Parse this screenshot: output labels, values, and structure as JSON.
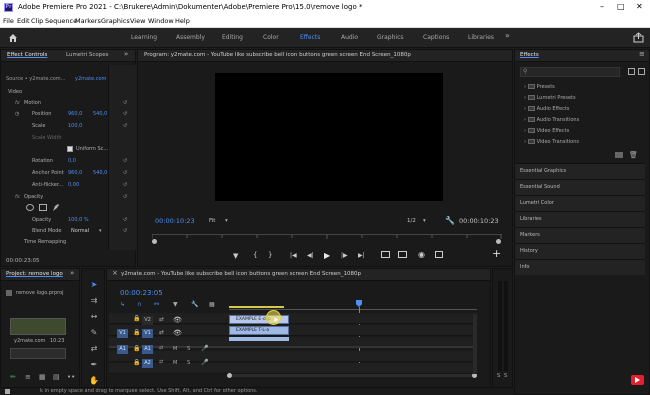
{
  "app": {
    "title": "Adobe Premiere Pro 2021 - C:\\Brukere\\Admin\\Dokumenter\\Adobe\\Premiere Pro\\15.0\\remove logo *",
    "icon_label": "Pr"
  },
  "menu": [
    "File",
    "Edit",
    "Clip",
    "Sequence",
    "Markers",
    "Graphics",
    "View",
    "Window",
    "Help"
  ],
  "workspaces": {
    "items": [
      "Learning",
      "Assembly",
      "Editing",
      "Color",
      "Effects",
      "Audio",
      "Graphics",
      "Captions",
      "Libraries"
    ],
    "active": "Effects"
  },
  "effect_controls": {
    "tabs": [
      "Effect Controls",
      "Lumetri Scopes"
    ],
    "source": "Source • y2mate.com...",
    "target": "y2mate.com - Y...",
    "video_label": "Video",
    "motion": "Motion",
    "position_label": "Position",
    "position_x": "960,0",
    "position_y": "540,0",
    "scale_label": "Scale",
    "scale_value": "100,0",
    "scale_width_label": "Scale Width",
    "uniform_scale": "Uniform Sc...",
    "rotation_label": "Rotation",
    "rotation_value": "0,0",
    "anchor_label": "Anchor Point",
    "anchor_x": "960,0",
    "anchor_y": "540,0",
    "antiflicker_label": "Anti-flicker...",
    "antiflicker_value": "0,00",
    "opacity_section": "Opacity",
    "opacity_label": "Opacity",
    "opacity_value": "100,0 %",
    "blend_label": "Blend Mode",
    "blend_value": "Normal",
    "time_remap": "Time Remapping",
    "timecode": "00:00:23:05"
  },
  "program_monitor": {
    "title": "Program: y2mate.com - YouTube like subscribe bell icon buttons green screen End Screen_1080p",
    "timecode": "00:00:10:23",
    "fit": "Fit",
    "quality": "1/2",
    "duration": "00:00:10:23"
  },
  "project": {
    "tab": "Project: remove logo",
    "filename": "remove logo.prproj",
    "clip_name": "y2mate.com",
    "clip_duration": "10:23"
  },
  "timeline": {
    "title": "y2mate.com - YouTube like subscribe bell icon buttons green screen End Screen_1080p",
    "timecode": "00:00:23:05",
    "tracks_video": [
      "V3",
      "V2",
      "V1"
    ],
    "tracks_audio": [
      "A1",
      "A2",
      "A3"
    ],
    "source_video": "V1",
    "source_audio": "A1",
    "clip_top": "EXAMPLE E-clip",
    "clip_bottom": "EXAMPLE T-L-a",
    "track_m": "M",
    "track_s": "S",
    "meter_labels": [
      "S",
      "S"
    ]
  },
  "effects_panel": {
    "title": "Effects",
    "folders": [
      "Presets",
      "Lumetri Presets",
      "Audio Effects",
      "Audio Transitions",
      "Video Effects",
      "Video Transitions"
    ],
    "sections": [
      "Essential Graphics",
      "Essential Sound",
      "Lumetri Color",
      "Libraries",
      "Markers",
      "History",
      "Info"
    ]
  },
  "status": {
    "text": "k in empty space and drag to marquee select. Use Shift, Alt, and Ctrl for other options."
  },
  "colors": {
    "accent": "#4d8ef7",
    "clip_fill": "#9fb9e6",
    "playhead": "#4d8ef7",
    "youtube_red": "#e5202e"
  }
}
